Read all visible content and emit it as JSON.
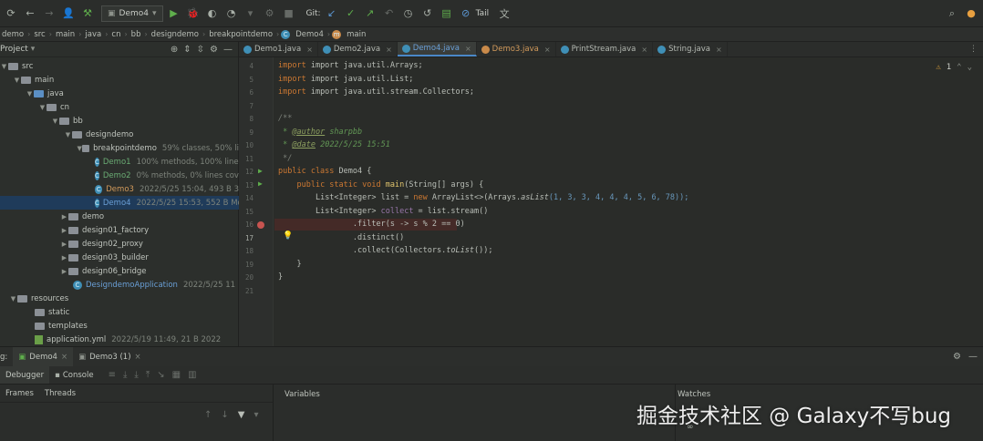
{
  "toolbar": {
    "run_config": "Demo4",
    "git_label": "Git:",
    "tail_label": "Tail"
  },
  "breadcrumb": [
    "demo",
    "src",
    "main",
    "java",
    "cn",
    "bb",
    "designdemo",
    "breakpointdemo",
    "Demo4",
    "main"
  ],
  "project": {
    "title": "Project",
    "tree": [
      {
        "label": "src",
        "meta": ""
      },
      {
        "label": "main",
        "meta": ""
      },
      {
        "label": "java",
        "meta": ""
      },
      {
        "label": "cn",
        "meta": ""
      },
      {
        "label": "bb",
        "meta": ""
      },
      {
        "label": "designdemo",
        "meta": ""
      },
      {
        "label": "breakpointdemo",
        "meta": "59% classes, 50% li"
      },
      {
        "label": "Demo1",
        "meta": "100% methods, 100% lines"
      },
      {
        "label": "Demo2",
        "meta": "0% methods, 0% lines cover"
      },
      {
        "label": "Demo3",
        "meta": "2022/5/25 15:04, 493 B 3"
      },
      {
        "label": "Demo4",
        "meta": "2022/5/25 15:53, 552 B Mo"
      },
      {
        "label": "demo",
        "meta": ""
      },
      {
        "label": "design01_factory",
        "meta": ""
      },
      {
        "label": "design02_proxy",
        "meta": ""
      },
      {
        "label": "design03_builder",
        "meta": ""
      },
      {
        "label": "design06_bridge",
        "meta": ""
      },
      {
        "label": "DesigndemoApplication",
        "meta": "2022/5/25 11"
      },
      {
        "label": "resources",
        "meta": ""
      },
      {
        "label": "static",
        "meta": ""
      },
      {
        "label": "templates",
        "meta": ""
      },
      {
        "label": "application.yml",
        "meta": "2022/5/19 11:49, 21 B 2022"
      }
    ]
  },
  "tabs": [
    "Demo1.java",
    "Demo2.java",
    "Demo4.java",
    "Demo3.java",
    "PrintStream.java",
    "String.java"
  ],
  "editor": {
    "line_numbers": [
      "4",
      "5",
      "6",
      "7",
      "8",
      "9",
      "10",
      "11",
      "12",
      "13",
      "14",
      "15",
      "16",
      "17",
      "18",
      "19",
      "20",
      "21"
    ],
    "warnings": "1",
    "code": {
      "l4": "import java.util.Arrays;",
      "l5": "import java.util.List;",
      "l6": "import java.util.stream.Collectors;",
      "l8": "/**",
      "l9_tag": "@author",
      "l9_val": "sharpbb",
      "l10_tag": "@date",
      "l10_val": "2022/5/25 15:51",
      "l11": "*/",
      "l12_kw": "public class",
      "l12_rest": "Demo4 {",
      "l13_kw": "public static void",
      "l13_fn": "main",
      "l13_rest": "(String[] args) {",
      "l14_a": "List<Integer> list = ",
      "l14_kw": "new",
      "l14_b": " ArrayList<>(Arrays.",
      "l14_c": "asList",
      "l14_d": "(1, 3, 3, 4, 4, 4, 5, 6, 78));",
      "l15_a": "List<Integer> ",
      "l15_var": "collect",
      "l15_b": " = list.stream()",
      "l16": ".filter(s -> s % 2 == 0)",
      "l17": ".distinct()",
      "l18_a": ".collect(Collectors.",
      "l18_b": "toList",
      "l18_c": "());",
      "l19": "}",
      "l20": "}"
    }
  },
  "debug": {
    "label": "g:",
    "sessions": [
      "Demo4",
      "Demo3 (1)"
    ],
    "subtabs": [
      "Debugger",
      "Console"
    ],
    "frames_tabs": [
      "Frames",
      "Threads"
    ],
    "variables_title": "Variables",
    "watches_title": "Watches"
  },
  "watermark": "掘金技术社区 @ Galaxy不写bug"
}
